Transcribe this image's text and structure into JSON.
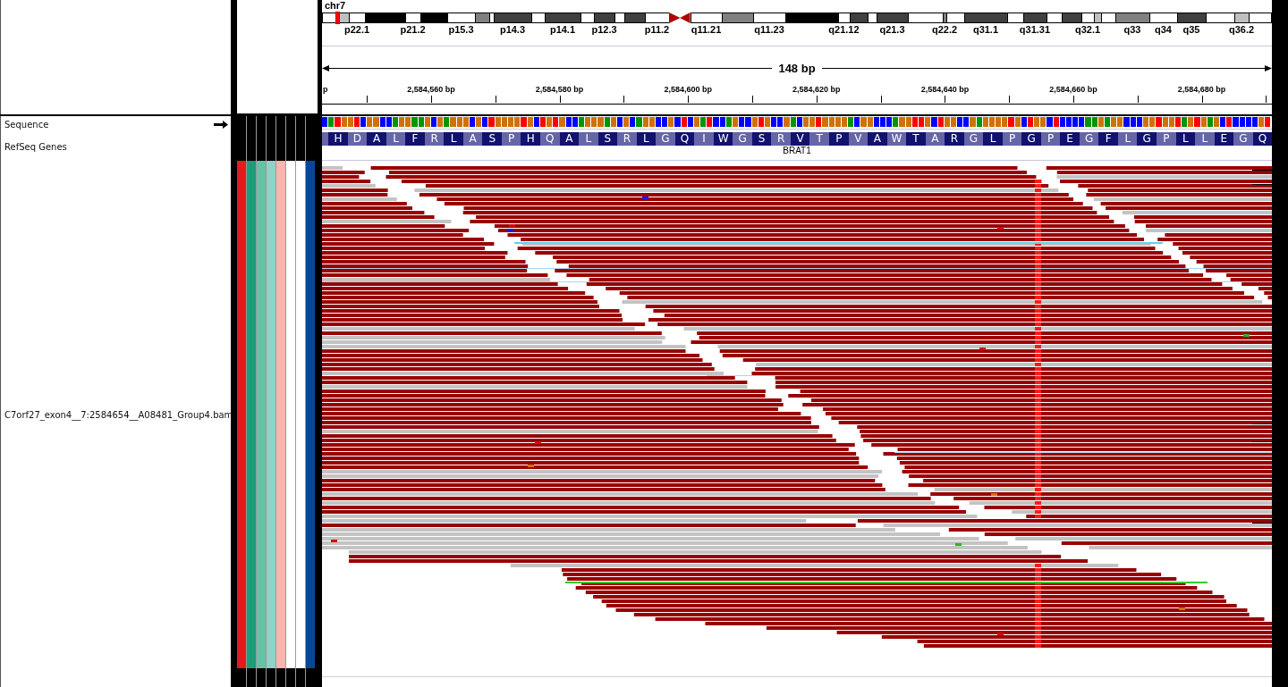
{
  "header": {
    "chromosome": "chr7",
    "ideogram": {
      "bands": [
        {
          "kind": "band",
          "color": "#ffffff",
          "marked": false
        },
        {
          "kind": "band",
          "color": "#c0c0c0",
          "marked": true
        },
        {
          "kind": "band",
          "color": "#ffffff",
          "marked": false,
          "label": "p22.1"
        },
        {
          "kind": "band",
          "color": "#000000",
          "marked": false
        },
        {
          "kind": "band",
          "color": "#ffffff",
          "marked": false,
          "label": "p21.2"
        },
        {
          "kind": "band",
          "color": "#000000",
          "marked": false
        },
        {
          "kind": "band",
          "color": "#ffffff",
          "marked": false,
          "label": "p15.3"
        },
        {
          "kind": "band",
          "color": "#808080",
          "marked": false
        },
        {
          "kind": "band",
          "color": "#ffffff",
          "marked": false
        },
        {
          "kind": "band",
          "color": "#404040",
          "marked": false,
          "label": "p14.3"
        },
        {
          "kind": "band",
          "color": "#ffffff",
          "marked": false
        },
        {
          "kind": "band",
          "color": "#404040",
          "marked": false,
          "label": "p14.1"
        },
        {
          "kind": "band",
          "color": "#ffffff",
          "marked": false
        },
        {
          "kind": "band",
          "color": "#404040",
          "marked": false,
          "label": "p12.3"
        },
        {
          "kind": "band",
          "color": "#ffffff",
          "marked": false
        },
        {
          "kind": "band",
          "color": "#404040",
          "marked": false
        },
        {
          "kind": "band",
          "color": "#ffffff",
          "marked": false,
          "label": "p11.2"
        },
        {
          "kind": "acen",
          "color": "#b00000",
          "marked": false
        },
        {
          "kind": "acen",
          "color": "#b00000",
          "marked": false
        },
        {
          "kind": "band",
          "color": "#ffffff",
          "marked": false,
          "label": "q11.21"
        },
        {
          "kind": "band",
          "color": "#808080",
          "marked": false
        },
        {
          "kind": "band",
          "color": "#ffffff",
          "marked": false,
          "label": "q11.23"
        },
        {
          "kind": "band",
          "color": "#000000",
          "marked": false
        },
        {
          "kind": "band",
          "color": "#ffffff",
          "marked": false,
          "label": "q21.12"
        },
        {
          "kind": "band",
          "color": "#404040",
          "marked": false
        },
        {
          "kind": "band",
          "color": "#ffffff",
          "marked": false
        },
        {
          "kind": "band",
          "color": "#404040",
          "marked": false,
          "label": "q21.3"
        },
        {
          "kind": "band",
          "color": "#ffffff",
          "marked": false
        },
        {
          "kind": "band",
          "color": "#808080",
          "marked": false,
          "label": "q22.2"
        },
        {
          "kind": "band",
          "color": "#ffffff",
          "marked": false
        },
        {
          "kind": "band",
          "color": "#404040",
          "marked": false,
          "label": "q31.1"
        },
        {
          "kind": "band",
          "color": "#ffffff",
          "marked": false
        },
        {
          "kind": "band",
          "color": "#404040",
          "marked": false,
          "label": "q31.31"
        },
        {
          "kind": "band",
          "color": "#ffffff",
          "marked": false
        },
        {
          "kind": "band",
          "color": "#404040",
          "marked": false
        },
        {
          "kind": "band",
          "color": "#ffffff",
          "marked": false,
          "label": "q32.1"
        },
        {
          "kind": "band",
          "color": "#c0c0c0",
          "marked": false
        },
        {
          "kind": "band",
          "color": "#ffffff",
          "marked": false
        },
        {
          "kind": "band",
          "color": "#808080",
          "marked": false,
          "label": "q33"
        },
        {
          "kind": "band",
          "color": "#ffffff",
          "marked": false,
          "label": "q34"
        },
        {
          "kind": "band",
          "color": "#404040",
          "marked": false,
          "label": "q35"
        },
        {
          "kind": "band",
          "color": "#ffffff",
          "marked": false
        },
        {
          "kind": "band",
          "color": "#c0c0c0",
          "marked": false,
          "label": "q36.2"
        },
        {
          "kind": "band",
          "color": "#ffffff",
          "marked": false
        }
      ]
    },
    "ruler": {
      "span": "148 bp",
      "ticks": [
        "p",
        "2,584,560 bp",
        "2,584,580 bp",
        "2,584,600 bp",
        "2,584,620 bp",
        "2,584,640 bp",
        "2,584,660 bp",
        "2,584,680 bp"
      ]
    }
  },
  "tracks": [
    {
      "kind": "sequence",
      "name": "Sequence",
      "bases": [
        {
          "color": "#0000ff"
        },
        {
          "color": "#009600"
        },
        {
          "color": "#ff0000"
        },
        {
          "color": "#d17105"
        },
        {
          "color": "#d17105"
        },
        {
          "color": "#ff0000"
        },
        {
          "color": "#0000ff"
        },
        {
          "color": "#d17105"
        },
        {
          "color": "#d17105"
        },
        {
          "color": "#0000ff"
        },
        {
          "color": "#0000ff"
        },
        {
          "color": "#009600"
        },
        {
          "color": "#d17105"
        },
        {
          "color": "#d17105"
        },
        {
          "color": "#009600"
        },
        {
          "color": "#009600"
        },
        {
          "color": "#d17105"
        },
        {
          "color": "#0000ff"
        },
        {
          "color": "#d17105"
        },
        {
          "color": "#009600"
        },
        {
          "color": "#d17105"
        },
        {
          "color": "#d17105"
        },
        {
          "color": "#d17105"
        },
        {
          "color": "#0000ff"
        },
        {
          "color": "#d17105"
        },
        {
          "color": "#0000ff"
        },
        {
          "color": "#ff0000"
        },
        {
          "color": "#d17105"
        },
        {
          "color": "#d17105"
        },
        {
          "color": "#d17105"
        },
        {
          "color": "#d17105"
        },
        {
          "color": "#ff0000"
        },
        {
          "color": "#d17105"
        },
        {
          "color": "#0000ff"
        },
        {
          "color": "#ff0000"
        },
        {
          "color": "#d17105"
        },
        {
          "color": "#ff0000"
        },
        {
          "color": "#d17105"
        },
        {
          "color": "#0000ff"
        },
        {
          "color": "#0000ff"
        },
        {
          "color": "#009600"
        },
        {
          "color": "#d17105"
        },
        {
          "color": "#d17105"
        },
        {
          "color": "#d17105"
        },
        {
          "color": "#009600"
        },
        {
          "color": "#d17105"
        },
        {
          "color": "#0000ff"
        },
        {
          "color": "#d17105"
        },
        {
          "color": "#0000ff"
        },
        {
          "color": "#009600"
        },
        {
          "color": "#d17105"
        },
        {
          "color": "#d17105"
        },
        {
          "color": "#0000ff"
        },
        {
          "color": "#0000ff"
        },
        {
          "color": "#d17105"
        },
        {
          "color": "#0000ff"
        },
        {
          "color": "#ff0000"
        },
        {
          "color": "#0000ff"
        },
        {
          "color": "#d17105"
        },
        {
          "color": "#009600"
        },
        {
          "color": "#ff0000"
        },
        {
          "color": "#0000ff"
        },
        {
          "color": "#0000ff"
        },
        {
          "color": "#009600"
        },
        {
          "color": "#d17105"
        },
        {
          "color": "#0000ff"
        },
        {
          "color": "#0000ff"
        },
        {
          "color": "#d17105"
        },
        {
          "color": "#ff0000"
        },
        {
          "color": "#d17105"
        },
        {
          "color": "#0000ff"
        },
        {
          "color": "#0000ff"
        },
        {
          "color": "#d17105"
        },
        {
          "color": "#009600"
        },
        {
          "color": "#0000ff"
        },
        {
          "color": "#d17105"
        },
        {
          "color": "#d17105"
        },
        {
          "color": "#ff0000"
        },
        {
          "color": "#d17105"
        },
        {
          "color": "#d17105"
        },
        {
          "color": "#d17105"
        },
        {
          "color": "#d17105"
        },
        {
          "color": "#009600"
        },
        {
          "color": "#0000ff"
        },
        {
          "color": "#d17105"
        },
        {
          "color": "#d17105"
        },
        {
          "color": "#0000ff"
        },
        {
          "color": "#0000ff"
        },
        {
          "color": "#0000ff"
        },
        {
          "color": "#009600"
        },
        {
          "color": "#d17105"
        },
        {
          "color": "#d17105"
        },
        {
          "color": "#ff0000"
        },
        {
          "color": "#ff0000"
        },
        {
          "color": "#d17105"
        },
        {
          "color": "#0000ff"
        },
        {
          "color": "#ff0000"
        },
        {
          "color": "#d17105"
        },
        {
          "color": "#d17105"
        },
        {
          "color": "#0000ff"
        },
        {
          "color": "#0000ff"
        },
        {
          "color": "#d17105"
        },
        {
          "color": "#009600"
        },
        {
          "color": "#d17105"
        },
        {
          "color": "#d17105"
        },
        {
          "color": "#d17105"
        },
        {
          "color": "#d17105"
        },
        {
          "color": "#ff0000"
        },
        {
          "color": "#d17105"
        },
        {
          "color": "#0000ff"
        },
        {
          "color": "#ff0000"
        },
        {
          "color": "#d17105"
        },
        {
          "color": "#d17105"
        },
        {
          "color": "#0000ff"
        },
        {
          "color": "#ff0000"
        },
        {
          "color": "#0000ff"
        },
        {
          "color": "#0000ff"
        },
        {
          "color": "#0000ff"
        },
        {
          "color": "#0000ff"
        },
        {
          "color": "#009600"
        },
        {
          "color": "#009600"
        },
        {
          "color": "#d17105"
        },
        {
          "color": "#009600"
        },
        {
          "color": "#d17105"
        },
        {
          "color": "#d17105"
        },
        {
          "color": "#0000ff"
        },
        {
          "color": "#0000ff"
        },
        {
          "color": "#0000ff"
        },
        {
          "color": "#d17105"
        },
        {
          "color": "#d17105"
        },
        {
          "color": "#ff0000"
        },
        {
          "color": "#d17105"
        },
        {
          "color": "#d17105"
        },
        {
          "color": "#ff0000"
        },
        {
          "color": "#009600"
        },
        {
          "color": "#d17105"
        },
        {
          "color": "#ff0000"
        },
        {
          "color": "#d17105"
        },
        {
          "color": "#009600"
        },
        {
          "color": "#d17105"
        },
        {
          "color": "#0000ff"
        },
        {
          "color": "#ff0000"
        },
        {
          "color": "#0000ff"
        },
        {
          "color": "#0000ff"
        },
        {
          "color": "#0000ff"
        },
        {
          "color": "#0000ff"
        },
        {
          "color": "#d17105"
        },
        {
          "color": "#ff0000"
        }
      ],
      "translation": [
        "H",
        "D",
        "A",
        "L",
        "F",
        "R",
        "L",
        "A",
        "S",
        "P",
        "H",
        "Q",
        "A",
        "L",
        "S",
        "R",
        "L",
        "G",
        "Q",
        "I",
        "W",
        "G",
        "S",
        "R",
        "V",
        "T",
        "P",
        "V",
        "A",
        "W",
        "T",
        "A",
        "R",
        "G",
        "L",
        "P",
        "G",
        "P",
        "E",
        "G",
        "F",
        "L",
        "G",
        "P",
        "L",
        "L",
        "E",
        "G",
        "Q"
      ]
    },
    {
      "kind": "gene",
      "name": "RefSeq Genes",
      "features": [
        {
          "name": "BRAT1"
        }
      ]
    },
    {
      "kind": "alignment",
      "name": "C7orf27_exon4__7:2584654__A08481_Group4.bam",
      "attributes": [
        {
          "color": "#e41a1c"
        },
        {
          "color": "#1b9e77"
        },
        {
          "color": "#66c2a5"
        },
        {
          "color": "#8dd3c7"
        },
        {
          "color": "#fbb4ae"
        },
        {
          "color": "#ffffff"
        },
        {
          "color": "#ffffff"
        },
        {
          "color": "#0b4696"
        }
      ]
    }
  ]
}
